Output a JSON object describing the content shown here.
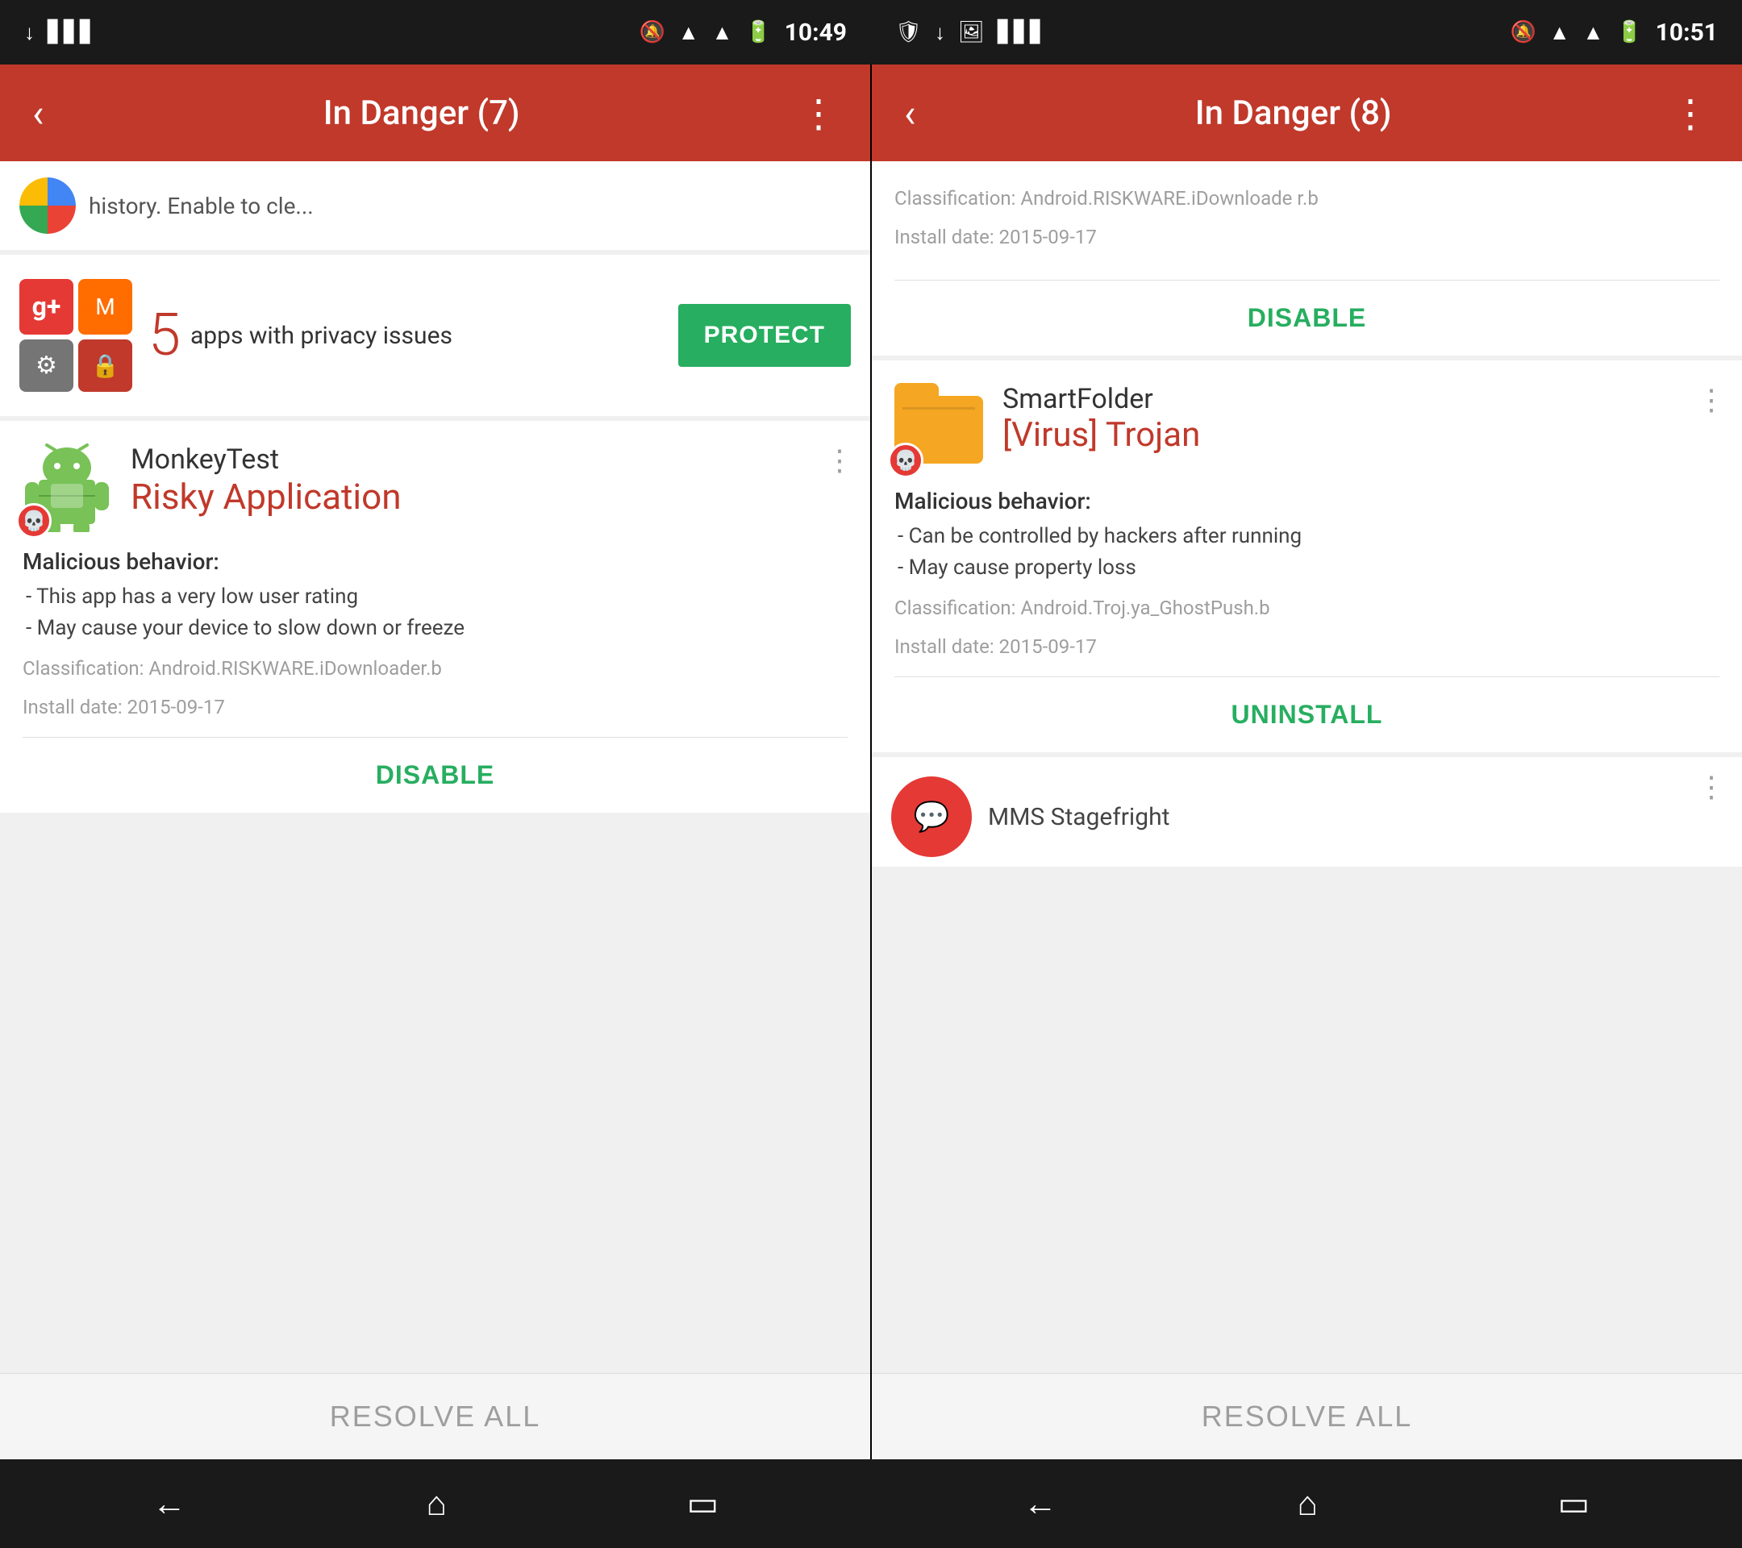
{
  "screens": [
    {
      "id": "left-screen",
      "statusBar": {
        "time": "10:49",
        "icons": [
          "notification",
          "signal",
          "wifi",
          "battery"
        ]
      },
      "appBar": {
        "title": "In Danger (7)",
        "backLabel": "‹",
        "menuLabel": "⋮"
      },
      "topCard": {
        "clippedText": "history. Enable to cle..."
      },
      "privacyCard": {
        "count": "5",
        "description": "apps with privacy issues",
        "protectLabel": "PROTECT"
      },
      "threatCard": {
        "appName": "MonkeyTest",
        "threatLevel": "Risky Application",
        "moreIcon": "⋮",
        "maliciousHeader": "Malicious behavior:",
        "behaviors": [
          "- This app has a very low user rating",
          "- May cause your device to slow down or freeze"
        ],
        "classification": "Classification: Android.RISKWARE.iDownloader.b",
        "installDate": "Install date: 2015-09-17",
        "actionLabel": "DISABLE"
      },
      "resolveAll": "RESOLVE ALL"
    },
    {
      "id": "right-screen",
      "statusBar": {
        "time": "10:51",
        "icons": [
          "notification",
          "signal",
          "wifi",
          "battery"
        ]
      },
      "appBar": {
        "title": "In Danger (8)",
        "backLabel": "‹",
        "menuLabel": "⋮"
      },
      "topCard": {
        "clippedClassification": "Classification: Android.RISKWARE.iDownloade r.b",
        "clippedInstall": "Install date: 2015-09-17",
        "actionLabel": "DISABLE"
      },
      "trojanCard": {
        "appName": "SmartFolder",
        "threatLevel": "[Virus] Trojan",
        "moreIcon": "⋮",
        "maliciousHeader": "Malicious behavior:",
        "behaviors": [
          "- Can be controlled by hackers after running",
          "- May cause property loss"
        ],
        "classification": "Classification: Android.Troj.ya_GhostPush.b",
        "installDate": "Install date: 2015-09-17",
        "actionLabel": "UNINSTALL"
      },
      "partialCard": {
        "appName": "MMS Stagefright"
      },
      "resolveAll": "RESOLVE ALL"
    }
  ],
  "navBar": {
    "back": "←",
    "home": "⌂",
    "recents": "▭"
  }
}
